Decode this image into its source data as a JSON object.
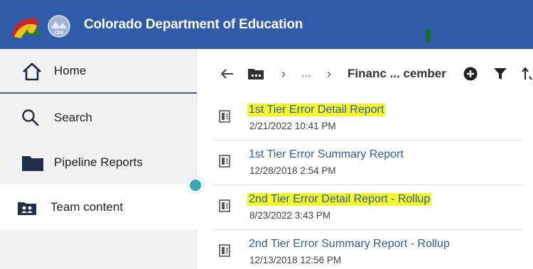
{
  "header": {
    "title": "Colorado Department of Education",
    "colors": {
      "background": "#2f5ba8",
      "text": "#ffffff"
    },
    "logo": {
      "icon": "colorado-logo-icon",
      "seal_text": "CDE"
    }
  },
  "sidebar": {
    "items": [
      {
        "label": "Home",
        "icon": "home-icon"
      },
      {
        "label": "Search",
        "icon": "search-icon"
      },
      {
        "label": "Pipeline Reports",
        "icon": "folder-icon"
      },
      {
        "label": "Team content",
        "icon": "team-folder-icon",
        "selected": true
      }
    ]
  },
  "toolbar": {
    "back_icon": "arrow-left-icon",
    "root_icon": "team-folder-icon",
    "ellipsis": "...",
    "current_folder": "Financ ... cember",
    "icons": [
      "add-circle-icon",
      "filter-icon",
      "sort-icon"
    ]
  },
  "reports": [
    {
      "title": "1st Tier Error Detail Report",
      "timestamp": "2/21/2022 10:41 PM",
      "highlighted": true
    },
    {
      "title": "1st Tier Error Summary Report",
      "timestamp": "12/28/2018 2:54 PM",
      "highlighted": false
    },
    {
      "title": "2nd Tier Error Detail Report - Rollup",
      "timestamp": "8/23/2022 3:43 PM",
      "highlighted": true
    },
    {
      "title": "2nd Tier Error Summary Report - Rollup",
      "timestamp": "12/13/2018 12:56 PM",
      "highlighted": false
    }
  ],
  "colors": {
    "link": "#2d5ea8",
    "highlight": "#f4f52a",
    "accent_dot": "#3aa7b5"
  }
}
